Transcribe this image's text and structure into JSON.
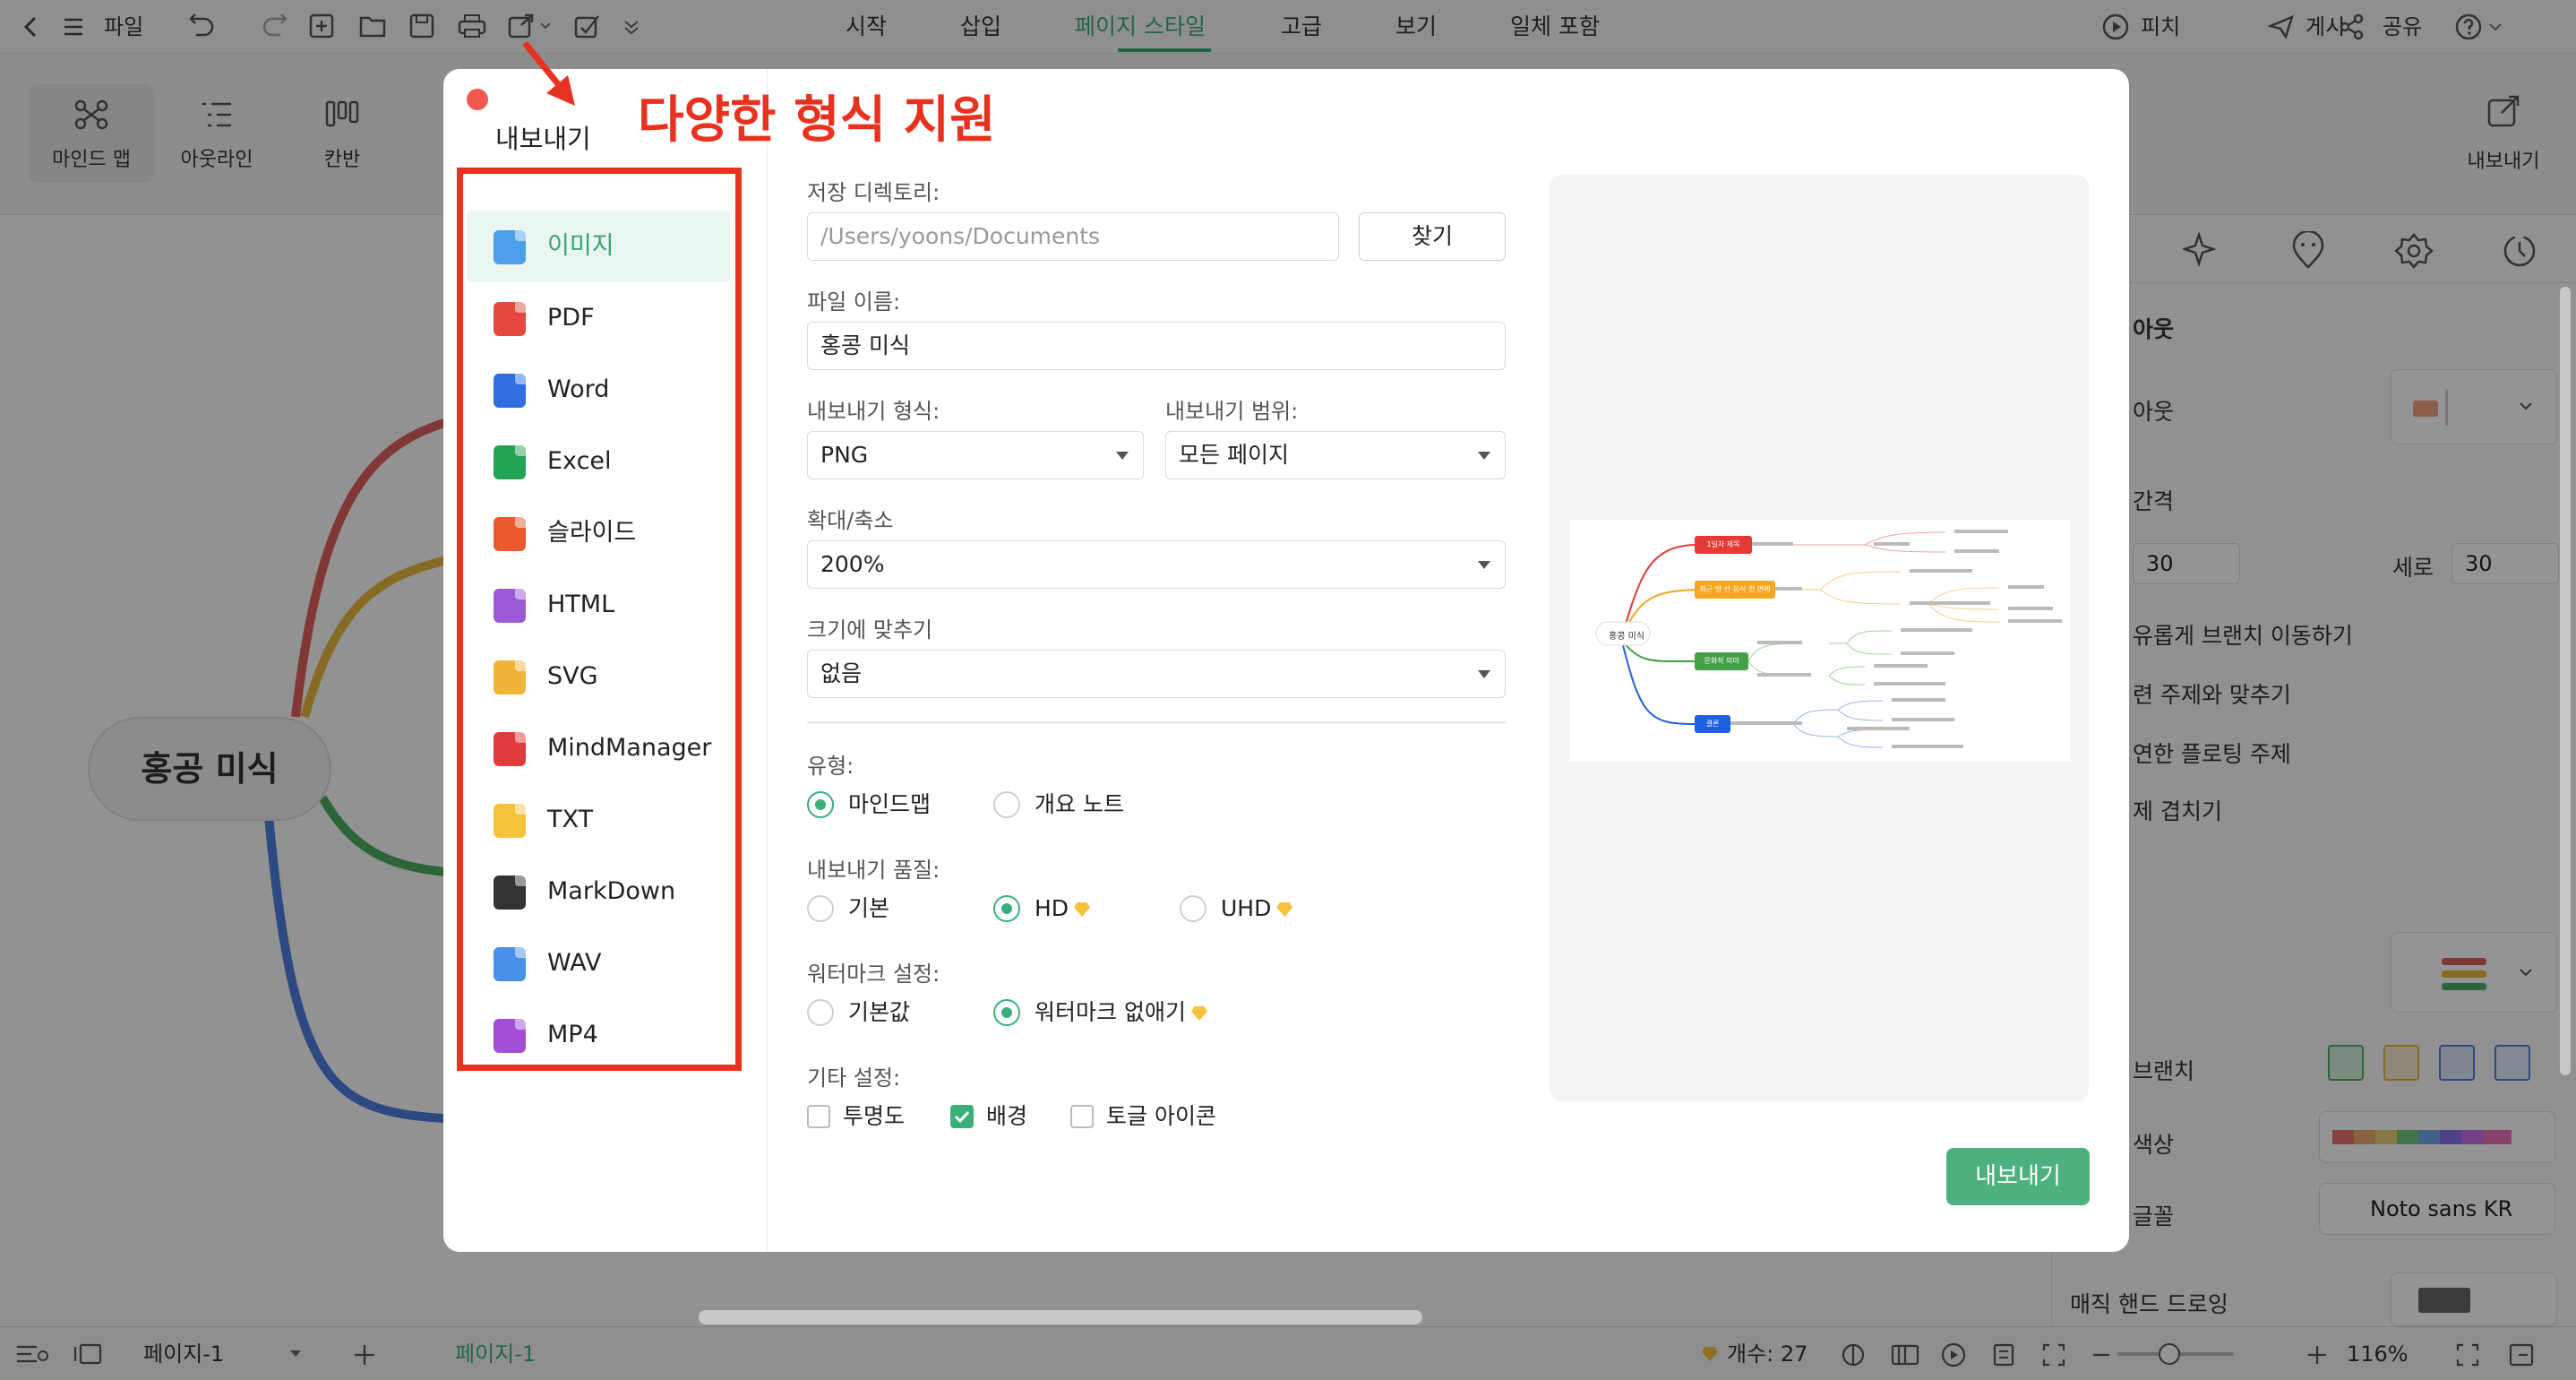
{
  "toolbar": {
    "file_label": "파일",
    "menu_tabs": [
      "시작",
      "삽입",
      "페이지 스타일",
      "고급",
      "보기",
      "일체 포함"
    ],
    "active_tab": "페이지 스타일",
    "pitch_label": "피치",
    "post_label": "게시",
    "share_label": "공유",
    "help_icon": "help-icon"
  },
  "ribbon": {
    "views": [
      "마인드 맵",
      "아웃라인",
      "칸반"
    ],
    "export_label": "내보내기"
  },
  "canvas": {
    "root_topic": "홍공 미식"
  },
  "right_panel": {
    "layout_title": "아웃",
    "layout_label": "아웃",
    "spacing_label": "간격",
    "horizontal_value": "30",
    "vertical_label": "세로",
    "vertical_value": "30",
    "opt_free_branch": "유롭게 브랜치 이동하기",
    "opt_align": "련 주제와 맞추기",
    "opt_floating": "연한 플로팅 주제",
    "opt_overlap": "제 겹치기",
    "branch_label": "브랜치",
    "color_label": "색상",
    "font_label": "글꼴",
    "font_value": "Noto sans KR",
    "hand_drawing_label": "매직 핸드 드로잉"
  },
  "dialog": {
    "title": "내보내기",
    "annotation": "다양한 형식 지원",
    "formats": [
      {
        "label": "이미지",
        "color": "#4a9fe8"
      },
      {
        "label": "PDF",
        "color": "#e5483f"
      },
      {
        "label": "Word",
        "color": "#2f6fe0"
      },
      {
        "label": "Excel",
        "color": "#23a455"
      },
      {
        "label": "슬라이드",
        "color": "#ea5a2c"
      },
      {
        "label": "HTML",
        "color": "#9b59d6"
      },
      {
        "label": "SVG",
        "color": "#f1b43a"
      },
      {
        "label": "MindManager",
        "color": "#e03b3b"
      },
      {
        "label": "TXT",
        "color": "#f5c33b"
      },
      {
        "label": "MarkDown",
        "color": "#333333"
      },
      {
        "label": "WAV",
        "color": "#4a8fe8"
      },
      {
        "label": "MP4",
        "color": "#a24fd6"
      }
    ],
    "active_format": "이미지",
    "save_dir_label": "저장 디렉토리:",
    "save_dir_value": "/Users/yoons/Documents",
    "browse_label": "찾기",
    "filename_label": "파일 이름:",
    "filename_value": "홍콩 미식",
    "export_format_label": "내보내기 형식:",
    "export_format_value": "PNG",
    "export_range_label": "내보내기 범위:",
    "export_range_value": "모든 페이지",
    "zoom_label": "확대/축소",
    "zoom_value": "200%",
    "fit_label": "크기에 맞추기",
    "fit_value": "없음",
    "type_label": "유형:",
    "type_options": [
      "마인드맵",
      "개요 노트"
    ],
    "type_selected": "마인드맵",
    "quality_label": "내보내기 품질:",
    "quality_options": [
      "기본",
      "HD",
      "UHD"
    ],
    "quality_selected": "HD",
    "watermark_label": "워터마크 설정:",
    "watermark_options": [
      "기본값",
      "워터마크 없애기"
    ],
    "watermark_selected": "워터마크 없애기",
    "other_label": "기타 설정:",
    "other_options": [
      {
        "label": "투명도",
        "checked": false
      },
      {
        "label": "배경",
        "checked": true
      },
      {
        "label": "토글 아이콘",
        "checked": false
      }
    ],
    "export_button": "내보내기",
    "preview": {
      "root": "홍콩 미식",
      "branches": [
        {
          "label": "1일차 제목",
          "color": "#e53935"
        },
        {
          "label": "최근 방 선 음식 얻 면에",
          "color": "#f5a623"
        },
        {
          "label": "문화적 의미",
          "color": "#43a047"
        },
        {
          "label": "결론",
          "color": "#1e5fe0"
        }
      ]
    }
  },
  "statusbar": {
    "page_tab": "페이지-1",
    "active_page": "페이지-1",
    "count_label": "개수: 27",
    "zoom": "116%"
  },
  "colors": {
    "accent": "#39b07a",
    "annotation_red": "#e8321f"
  }
}
